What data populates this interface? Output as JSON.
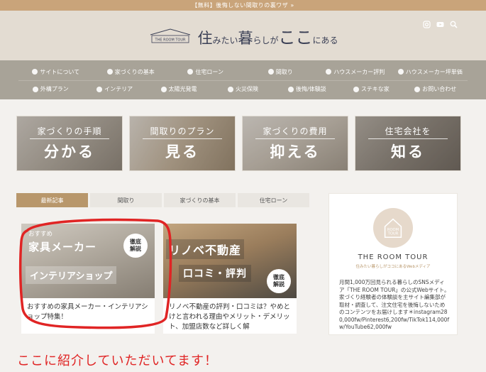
{
  "promo_bar": "【無料】後悔しない間取りの裏ワザ »",
  "logo": {
    "house_text": "THE ROOM TOUR",
    "tag_1": "住",
    "tag_2": "みたい",
    "tag_3": "暮",
    "tag_4": "らしが",
    "tag_5": "ここ",
    "tag_6": "にある"
  },
  "header_icons": [
    "instagram-icon",
    "youtube-icon",
    "search-icon"
  ],
  "nav": {
    "row1": [
      {
        "icon": "info-icon",
        "label": "サイトについて"
      },
      {
        "icon": "pencil-icon",
        "label": "家づくりの基本"
      },
      {
        "icon": "building-icon",
        "label": "住宅ローン"
      },
      {
        "icon": "floorplan-icon",
        "label": "間取り"
      },
      {
        "icon": "megaphone-icon",
        "label": "ハウスメーカー評判"
      },
      {
        "icon": "info-icon",
        "label": "ハウスメーカー坪単価"
      }
    ],
    "row2": [
      {
        "icon": "gear-icon",
        "label": "外構プラン"
      },
      {
        "icon": "lamp-icon",
        "label": "インテリア"
      },
      {
        "icon": "sun-icon",
        "label": "太陽光発電"
      },
      {
        "icon": "fire-icon",
        "label": "火災保険"
      },
      {
        "icon": "chat-icon",
        "label": "後悔/体験談"
      },
      {
        "icon": "star-icon",
        "label": "ステキな家"
      },
      {
        "icon": "mail-icon",
        "label": "お問い合わせ"
      }
    ]
  },
  "banners": [
    {
      "title": "家づくりの手順",
      "action": "分かる"
    },
    {
      "title": "間取りのプラン",
      "action": "見る"
    },
    {
      "title": "家づくりの費用",
      "action": "抑える"
    },
    {
      "title": "住宅会社を",
      "action": "知る"
    }
  ],
  "tabs": [
    "最新記事",
    "間取り",
    "家づくりの基本",
    "住宅ローン"
  ],
  "cards": [
    {
      "img_line1": "おすすめ",
      "img_line2": "家具メーカー",
      "img_line3": "インテリアショップ",
      "badge_1": "徹底",
      "badge_2": "解説",
      "text": "おすすめの家具メーカー・インテリアショップ特集！"
    },
    {
      "img_line1": "リノベ不動産",
      "img_line2": "口コミ・評判",
      "badge_1": "徹底",
      "badge_2": "解説",
      "text": "リノベ不動産の評判・口コミは？やめとけと言われる理由やメリット・デメリット、加盟店数など詳しく解"
    }
  ],
  "sidebar": {
    "logo_line1": "ROOM",
    "logo_line2": "TOUR",
    "brand": "THE ROOM TOUR",
    "sub": "住みたい暮らしがココにあるWebメディア",
    "desc": "月間1,000万回見られる暮らしのSNSメディア「THE ROOM TOUR」の公式Webサイト。家づくり経験者の体験談を主サイト編集部が取材・調査して、注文住宅を後悔しないためのコンテンツをお届けします＊instagram280,000fw/Pinterest6,200fw/TikTok114,000fw/YouTube62,000fw"
  },
  "annotation": "ここに紹介していただいてます！",
  "colors": {
    "accent": "#b8976b",
    "nav_bg": "#a8a398",
    "header_bg": "#e3dcd2",
    "annotation_red": "#e02424"
  }
}
